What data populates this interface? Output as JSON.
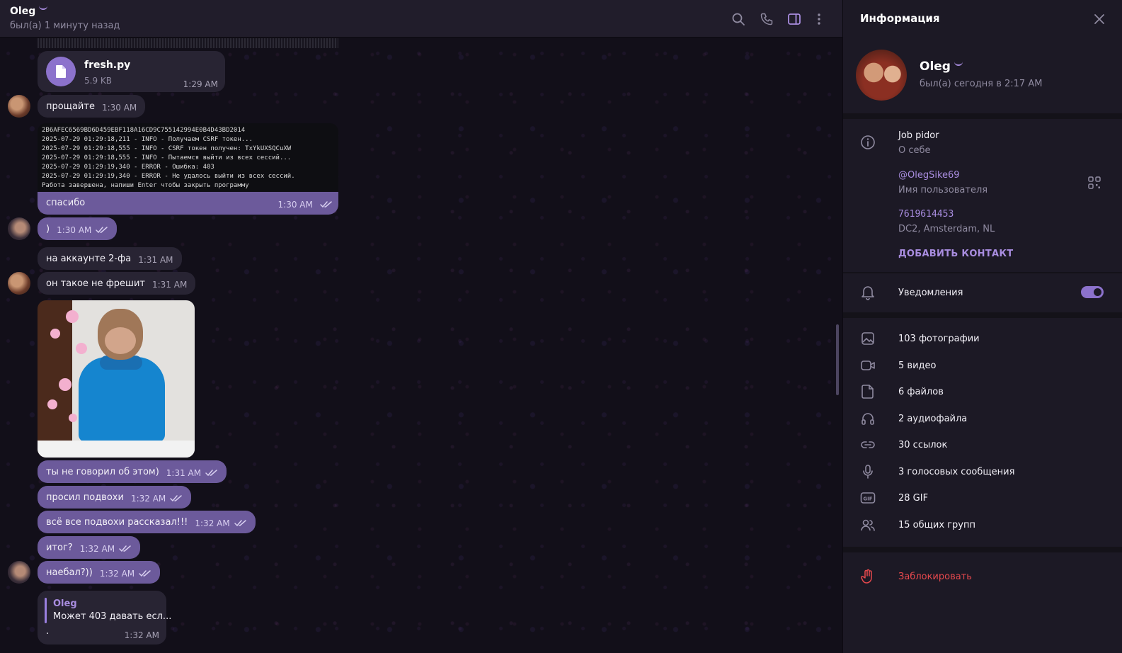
{
  "chat_header": {
    "name": "Oleg",
    "status": "был(а) 1 минуту назад"
  },
  "messages": {
    "file": {
      "name": "fresh.py",
      "size": "5.9 KB",
      "time": "1:29 AM"
    },
    "m1": {
      "text": "прощайте",
      "time": "1:30 AM"
    },
    "terminal_lines": [
      "2B6AFEC6569BD6D459EBF118A16CD9C755142994E0B4D43BD2014",
      "2025-07-29 01:29:18,211 - INFO - Получаем CSRF токен...",
      "2025-07-29 01:29:18,555 - INFO - CSRF токен получен: TxYkUXSQCuXW",
      "2025-07-29 01:29:18,555 - INFO - Пытаемся выйти из всех сессий...",
      "2025-07-29 01:29:19,340 - ERROR - Ошибка: 403",
      "2025-07-29 01:29:19,340 - ERROR - Не удалось выйти из всех сессий.",
      "Работа завершена, напиши Enter чтобы закрыть программу"
    ],
    "m2": {
      "text": "спасибо",
      "time": "1:30 AM"
    },
    "m3": {
      "text": ")",
      "time": "1:30 AM"
    },
    "m4": {
      "text": "на аккаунте 2-фа",
      "time": "1:31 AM"
    },
    "m5": {
      "text": "он такое не фрешит",
      "time": "1:31 AM"
    },
    "m6": {
      "text": "ты не говорил об этом)",
      "time": "1:31 AM"
    },
    "m7": {
      "text": "просил подвохи",
      "time": "1:32 AM"
    },
    "m8": {
      "text": "всё все подвохи рассказал!!!",
      "time": "1:32 AM"
    },
    "m9": {
      "text": "итог?",
      "time": "1:32 AM"
    },
    "m10": {
      "text": "наебал?))",
      "time": "1:32 AM"
    },
    "reply": {
      "author": "Oleg",
      "quote": "Может 403 давать есл...",
      "text": ".",
      "time": "1:32 AM"
    }
  },
  "info_panel": {
    "title": "Информация",
    "profile_name": "Oleg",
    "profile_status": "был(а) сегодня в 2:17 AM",
    "bio": "Job pidor",
    "bio_label": "О себе",
    "username": "@OlegSike69",
    "username_label": "Имя пользователя",
    "user_id": "7619614453",
    "dc_label": "DC2, Amsterdam, NL",
    "add_contact": "ДОБАВИТЬ КОНТАКТ",
    "notifications": "Уведомления",
    "notifications_on": true,
    "media": [
      {
        "icon": "photo-icon",
        "label": "103 фотографии"
      },
      {
        "icon": "video-icon",
        "label": "5 видео"
      },
      {
        "icon": "file-icon",
        "label": "6 файлов"
      },
      {
        "icon": "headphones-icon",
        "label": "2 аудиофайла"
      },
      {
        "icon": "link-icon",
        "label": "30 ссылок"
      },
      {
        "icon": "microphone-icon",
        "label": "3 голосовых сообщения"
      },
      {
        "icon": "gif-icon",
        "label": "28 GIF"
      },
      {
        "icon": "group-icon",
        "label": "15 общих групп"
      }
    ],
    "block": "Заблокировать"
  },
  "colors": {
    "accent": "#8c72cc",
    "outgoing_bubble": "#6c5a9b",
    "incoming_bubble": "#282433",
    "danger": "#e5484d"
  }
}
